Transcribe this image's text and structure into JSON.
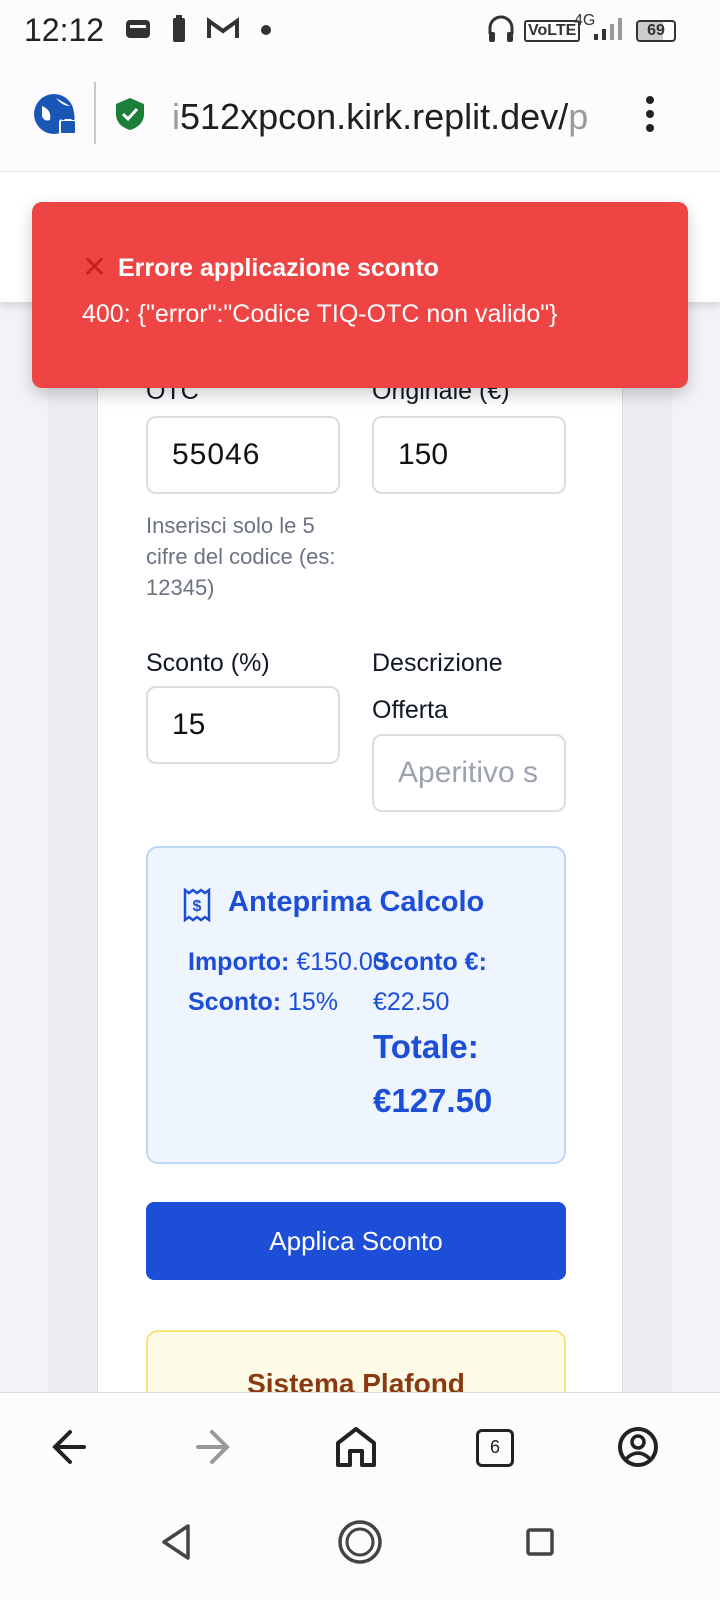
{
  "status_bar": {
    "time": "12:12",
    "volte": "VoLTE",
    "network": "4G",
    "battery": "69"
  },
  "browser": {
    "url_prefix": "i",
    "url_main": "512xpcon.kirk.replit.dev/",
    "url_suffix": "p",
    "tab_count": "6"
  },
  "toast": {
    "title": "Errore applicazione sconto",
    "message": "400: {\"error\":\"Codice TIQ-OTC non valido\"}"
  },
  "form": {
    "otc_label": "OTC",
    "otc_value": "55046",
    "otc_help": "Inserisci solo le 5 cifre del codice (es: 12345)",
    "amount_label": "Originale (€)",
    "amount_value": "150",
    "discount_label": "Sconto (%)",
    "discount_value": "15",
    "description_label": "Descrizione Offerta",
    "description_placeholder": "Aperitivo s"
  },
  "preview": {
    "title": "Anteprima Calcolo",
    "importo_label": "Importo:",
    "importo_value": "€150.00",
    "sconto_pct_label": "Sconto:",
    "sconto_pct_value": "15%",
    "sconto_eur_label": "Sconto €:",
    "sconto_eur_value": "€22.50",
    "totale_label": "Totale:",
    "totale_value": "€127.50"
  },
  "apply_button": "Applica Sconto",
  "plafond_title": "Sistema Plafond",
  "colors": {
    "toast": "#ef4444",
    "primary": "#1d4ed8",
    "preview_bg": "#eef5ff",
    "plafond_bg": "#fefbe6"
  }
}
